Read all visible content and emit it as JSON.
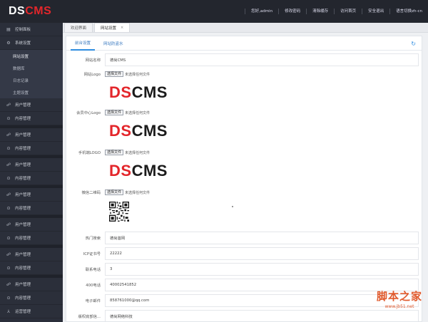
{
  "app": {
    "logo_ds": "DS",
    "logo_cms": "CMS"
  },
  "topnav": [
    "您好,admin",
    "修改密码",
    "清除缓存",
    "访问首页",
    "安全退出",
    "语言切换zh-cn"
  ],
  "sidebar": {
    "dashboard": {
      "icon": "dashboard-icon",
      "label": "控制面板"
    },
    "system": {
      "icon": "gear-icon",
      "label": "系统设置"
    },
    "system_sub": [
      "网站设置",
      "数据库",
      "日志记录",
      "主题设置"
    ],
    "groups": [
      {
        "user": "用户管理",
        "content": "内容管理"
      },
      {
        "user": "用户管理",
        "content": "内容管理"
      },
      {
        "user": "用户管理",
        "content": "内容管理"
      },
      {
        "user": "用户管理",
        "content": "内容管理"
      },
      {
        "user": "用户管理",
        "content": "内容管理"
      },
      {
        "user": "用户管理",
        "content": "内容管理"
      }
    ],
    "last_group": {
      "user": "用户管理",
      "content": "内容管理",
      "ops": "运营管理"
    }
  },
  "tabs": [
    {
      "label": "欢迎界面",
      "active": false
    },
    {
      "label": "网站设置",
      "active": true,
      "close": "×"
    }
  ],
  "subtabs": [
    "前台设置",
    "网站防盗水"
  ],
  "file": {
    "button": "选择文件",
    "none": "未选择任何文件"
  },
  "logo_image": {
    "a": "DS",
    "b": "CMS"
  },
  "form": {
    "site_name": {
      "label": "网站名称",
      "value": "德尚CMS"
    },
    "site_logo": {
      "label": "网站Logo"
    },
    "member_logo": {
      "label": "会员中心Logo"
    },
    "mobile_logo": {
      "label": "手机端LOGO"
    },
    "wechat_qr": {
      "label": "微信二维码"
    },
    "hot_search": {
      "label": "热门搜索",
      "value": "德尚首网"
    },
    "icp": {
      "label": "ICP证书号",
      "value": "22222"
    },
    "contact": {
      "label": "联系电话",
      "value": "3"
    },
    "tel400": {
      "label": "400电话",
      "value": "40002541852"
    },
    "email": {
      "label": "电子邮件",
      "value": "858761000@qq.com"
    },
    "copyright": {
      "label": "版权底部信...",
      "value": "德尚网络科技"
    }
  },
  "watermark": {
    "text": "脚本之家",
    "url": "www.jb51.net"
  },
  "colors": {
    "accent": "#2e8de0",
    "brand_red": "#e3262b",
    "topbar": "#23262e",
    "sidebar": "#2b2f3a"
  }
}
